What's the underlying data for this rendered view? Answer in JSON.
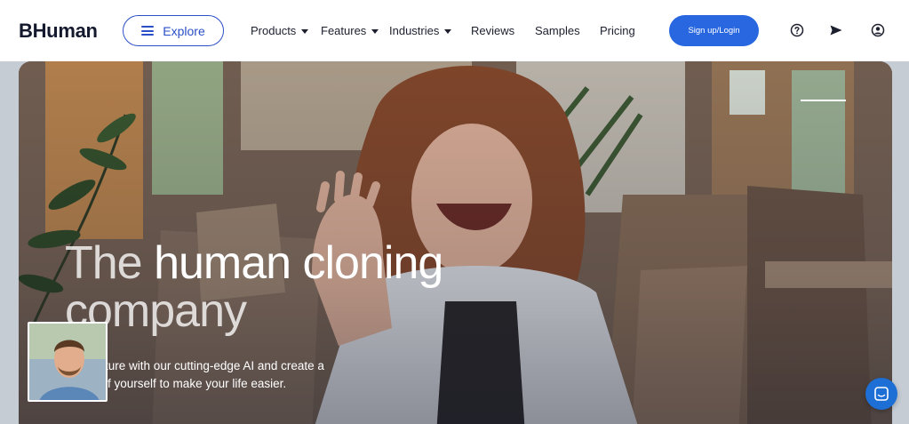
{
  "header": {
    "logo": "BHuman",
    "explore_label": "Explore",
    "nav": [
      {
        "label": "Products",
        "dropdown": true
      },
      {
        "label": "Features",
        "dropdown": true
      },
      {
        "label": "Industries",
        "dropdown": true
      },
      {
        "label": "Reviews",
        "dropdown": false
      },
      {
        "label": "Samples",
        "dropdown": false
      },
      {
        "label": "Pricing",
        "dropdown": false
      }
    ],
    "signup_label": "Sign up/Login",
    "icons": [
      "help-icon",
      "send-icon",
      "account-icon"
    ]
  },
  "hero": {
    "title_light": "The",
    "title_bold": "human cloning",
    "title_line2": "company",
    "desc_line1": "o the future with our cutting-edge AI and create a",
    "desc_line2": "ersion of yourself to make your life easier."
  },
  "colors": {
    "brand_blue": "#2867e0",
    "explore_blue": "#2b4fc7",
    "logo_dark": "#15192e",
    "chat_blue": "#1d6fd6"
  }
}
